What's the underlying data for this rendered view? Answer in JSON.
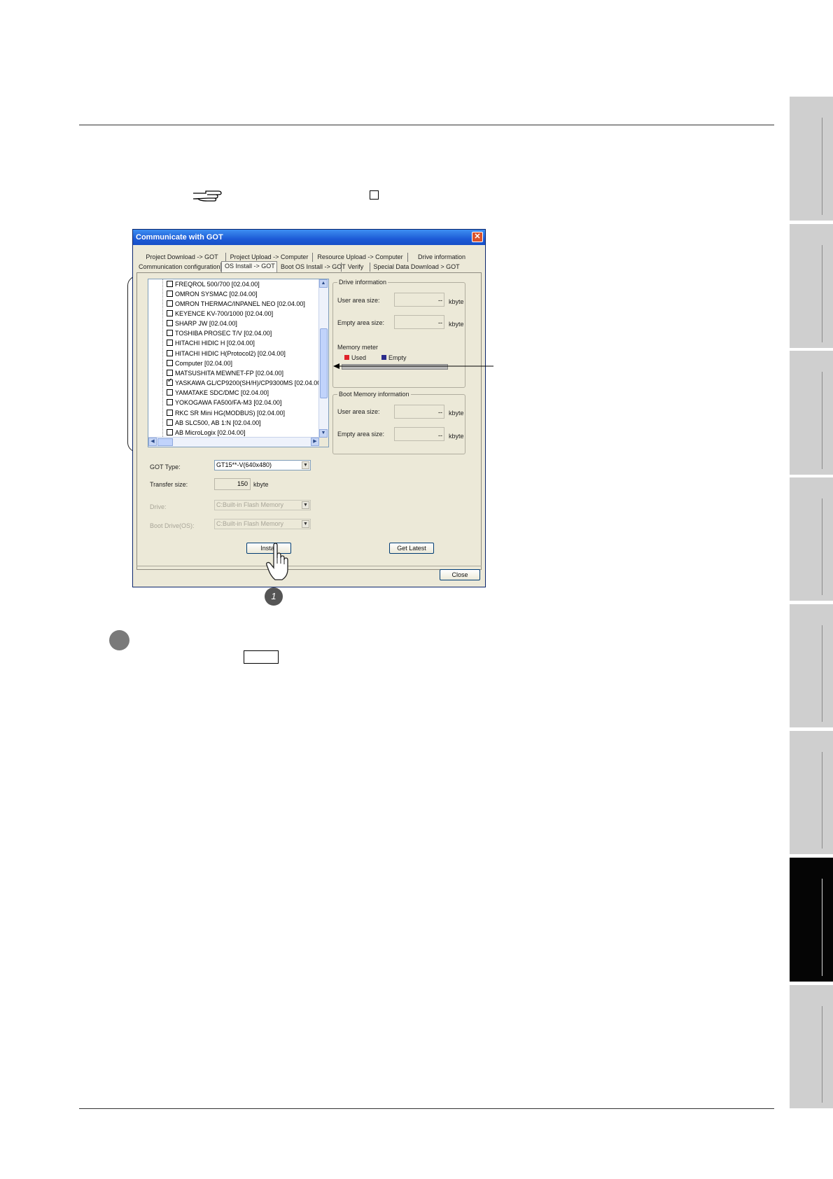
{
  "dialog": {
    "title": "Communicate with GOT",
    "tabs_row1": [
      "Project Download -> GOT",
      "Project Upload -> Computer",
      "Resource Upload -> Computer",
      "Drive information"
    ],
    "tabs_row2": [
      "Communication configuration",
      "OS Install -> GOT",
      "Boot OS Install -> GOT",
      "Verify",
      "Special Data Download > GOT"
    ],
    "selected_tab": "OS Install -> GOT",
    "os_list": [
      {
        "label": "FREQROL 500/700 [02.04.00]",
        "checked": false
      },
      {
        "label": "OMRON SYSMAC [02.04.00]",
        "checked": false
      },
      {
        "label": "OMRON THERMAC/INPANEL NEO [02.04.00]",
        "checked": false
      },
      {
        "label": "KEYENCE KV-700/1000 [02.04.00]",
        "checked": false
      },
      {
        "label": "SHARP JW [02.04.00]",
        "checked": false
      },
      {
        "label": "TOSHIBA PROSEC T/V [02.04.00]",
        "checked": false
      },
      {
        "label": "HITACHI HIDIC H [02.04.00]",
        "checked": false
      },
      {
        "label": "HITACHI HIDIC H(Protocol2) [02.04.00]",
        "checked": false
      },
      {
        "label": "Computer [02.04.00]",
        "checked": false
      },
      {
        "label": "MATSUSHITA MEWNET-FP [02.04.00]",
        "checked": false
      },
      {
        "label": "YASKAWA GL/CP9200(SH/H)/CP9300MS [02.04.00]",
        "checked": true
      },
      {
        "label": "YAMATAKE SDC/DMC [02.04.00]",
        "checked": false
      },
      {
        "label": "YOKOGAWA FA500/FA-M3 [02.04.00]",
        "checked": false
      },
      {
        "label": "RKC SR Mini HG(MODBUS) [02.04.00]",
        "checked": false
      },
      {
        "label": "AB SLC500, AB 1:N [02.04.00]",
        "checked": false
      },
      {
        "label": "AB MicroLogix [02.04.00]",
        "checked": false
      }
    ],
    "drive_info": {
      "caption": "Drive information",
      "user_area_label": "User area size:",
      "empty_area_label": "Empty area size:",
      "value": "--",
      "unit": "kbyte",
      "memory_meter_label": "Memory meter",
      "legend_used": "Used",
      "legend_empty": "Empty",
      "used_color": "#e0232c",
      "empty_color": "#2c2c8c"
    },
    "boot_info": {
      "caption": "Boot Memory information",
      "user_area_label": "User area size:",
      "empty_area_label": "Empty area size:",
      "value": "--",
      "unit": "kbyte"
    },
    "got_type_label": "GOT Type:",
    "got_type_value": "GT15**-V(640x480)",
    "transfer_size_label": "Transfer size:",
    "transfer_size_value": "150",
    "transfer_size_unit": "kbyte",
    "drive_label": "Drive:",
    "drive_value": "C:Built-in Flash Memory",
    "boot_drive_label": "Boot Drive(OS):",
    "boot_drive_value": "C:Built-in Flash Memory",
    "install_button": "Install",
    "get_latest_button": "Get Latest",
    "close_button": "Close"
  },
  "step_number": "1"
}
